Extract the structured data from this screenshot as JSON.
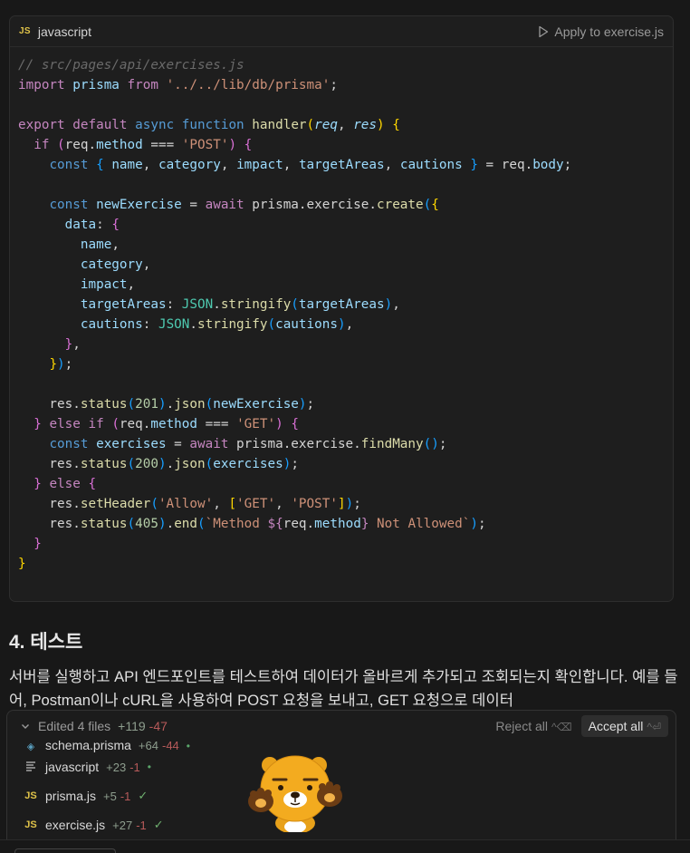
{
  "code_block": {
    "language": "javascript",
    "lang_badge": "JS",
    "apply_label": "Apply to exercise.js",
    "code": {
      "comment": "// src/pages/api/exercises.js",
      "import_path": "'../../lib/db/prisma'",
      "post_str": "'POST'",
      "get_str": "'GET'",
      "allow_str": "'Allow'",
      "n201": "201",
      "n200": "200",
      "n405": "405",
      "tpl_a": "`Method ",
      "tpl_b": " Not Allowed`"
    }
  },
  "section": {
    "heading": "4. 테스트",
    "paragraph": "서버를 실행하고 API 엔드포인트를 테스트하여 데이터가 올바르게 추가되고 조회되는지 확인합니다. 예를 들어, Postman이나 cURL을 사용하여 POST 요청을 보내고, GET 요청으로 데이터"
  },
  "edit_panel": {
    "summary": "Edited 4 files",
    "added": "+119",
    "removed": "-47",
    "reject_label": "Reject all",
    "reject_shortcut": "^⌫",
    "accept_label": "Accept all",
    "accept_shortcut": "^⏎",
    "files": [
      {
        "name": "schema.prisma",
        "added": "+64",
        "removed": "-44",
        "icon": "prisma-icon",
        "status": "•"
      },
      {
        "name": "javascript",
        "added": "+23",
        "removed": "-1",
        "icon": "lines-icon",
        "status": "•"
      },
      {
        "name": "prisma.js",
        "added": "+5",
        "removed": "-1",
        "icon": "js-icon",
        "status": "✓"
      },
      {
        "name": "exercise.js",
        "added": "+27",
        "removed": "-1",
        "icon": "js-icon",
        "status": "✓"
      }
    ]
  },
  "colors": {
    "accent_js": "#e0c349",
    "added": "#8e9e8e",
    "removed": "#b75a5a",
    "background": "#181818"
  }
}
